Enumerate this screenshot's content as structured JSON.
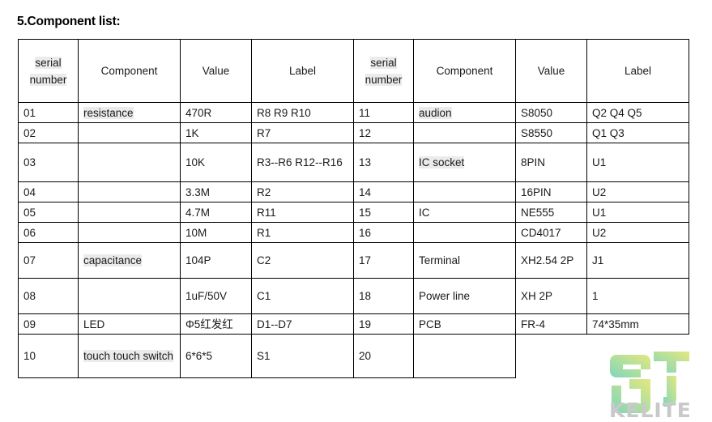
{
  "page": {
    "title": "5.Component list:"
  },
  "table": {
    "headers": {
      "serial_number": "serial number",
      "component": "Component",
      "value": "Value",
      "label": "Label"
    },
    "left_rows": [
      {
        "sn": "01",
        "component": "resistance",
        "component_highlight": true,
        "value": "470R",
        "label": "R8  R9  R10",
        "height": "r-short"
      },
      {
        "sn": "02",
        "component": "",
        "component_highlight": false,
        "value": "1K",
        "label": "R7",
        "height": "r-short"
      },
      {
        "sn": "03",
        "component": "",
        "component_highlight": false,
        "value": "10K",
        "label": "R3--R6   R12--R16",
        "height": "r-tall"
      },
      {
        "sn": "04",
        "component": "",
        "component_highlight": false,
        "value": "3.3M",
        "label": "R2",
        "height": "r-short"
      },
      {
        "sn": "05",
        "component": "",
        "component_highlight": false,
        "value": "4.7M",
        "label": "R11",
        "height": "r-short"
      },
      {
        "sn": "06",
        "component": "",
        "component_highlight": false,
        "value": "10M",
        "label": "R1",
        "height": "r-short"
      },
      {
        "sn": "07",
        "component": "capacitance",
        "component_highlight": true,
        "value": "104P",
        "label": "C2",
        "height": "r-mid"
      },
      {
        "sn": "08",
        "component": "",
        "component_highlight": false,
        "value": "1uF/50V",
        "label": "C1",
        "height": "r-mid"
      },
      {
        "sn": "09",
        "component": "LED",
        "component_highlight": false,
        "value": "Φ5红发红",
        "label": "D1--D7",
        "height": "r-short"
      },
      {
        "sn": "10",
        "component": "touch touch switch",
        "component_highlight": true,
        "value": "6*6*5",
        "label": "S1",
        "height": "r-last"
      }
    ],
    "right_rows": [
      {
        "sn": "11",
        "component": "audion",
        "component_highlight": true,
        "value": "S8050",
        "label": "Q2  Q4  Q5"
      },
      {
        "sn": "12",
        "component": "",
        "component_highlight": false,
        "value": "S8550",
        "label": "Q1  Q3"
      },
      {
        "sn": "13",
        "component": "IC socket",
        "component_highlight": true,
        "value": "8PIN",
        "label": "U1"
      },
      {
        "sn": "14",
        "component": "",
        "component_highlight": false,
        "value": "16PIN",
        "label": "U2"
      },
      {
        "sn": "15",
        "component": "IC",
        "component_highlight": false,
        "value": "NE555",
        "label": "U1"
      },
      {
        "sn": "16",
        "component": "",
        "component_highlight": false,
        "value": "CD4017",
        "label": "U2"
      },
      {
        "sn": "17",
        "component": "Terminal",
        "component_highlight": false,
        "value": "XH2.54 2P",
        "label": "J1"
      },
      {
        "sn": "18",
        "component": "Power line",
        "component_highlight": false,
        "value": "XH 2P",
        "label": "1"
      },
      {
        "sn": "19",
        "component": "PCB",
        "component_highlight": false,
        "value": "FR-4",
        "label": "74*35mm"
      },
      {
        "sn": "20",
        "component": "",
        "component_highlight": false,
        "value": "",
        "label": ""
      }
    ]
  },
  "watermark": {
    "brand_text": "KELITE",
    "logo_name": "gt-logo",
    "color_start": "#7fd6bc",
    "color_end": "#e3e87f",
    "text_color": "#c9c9c9"
  }
}
